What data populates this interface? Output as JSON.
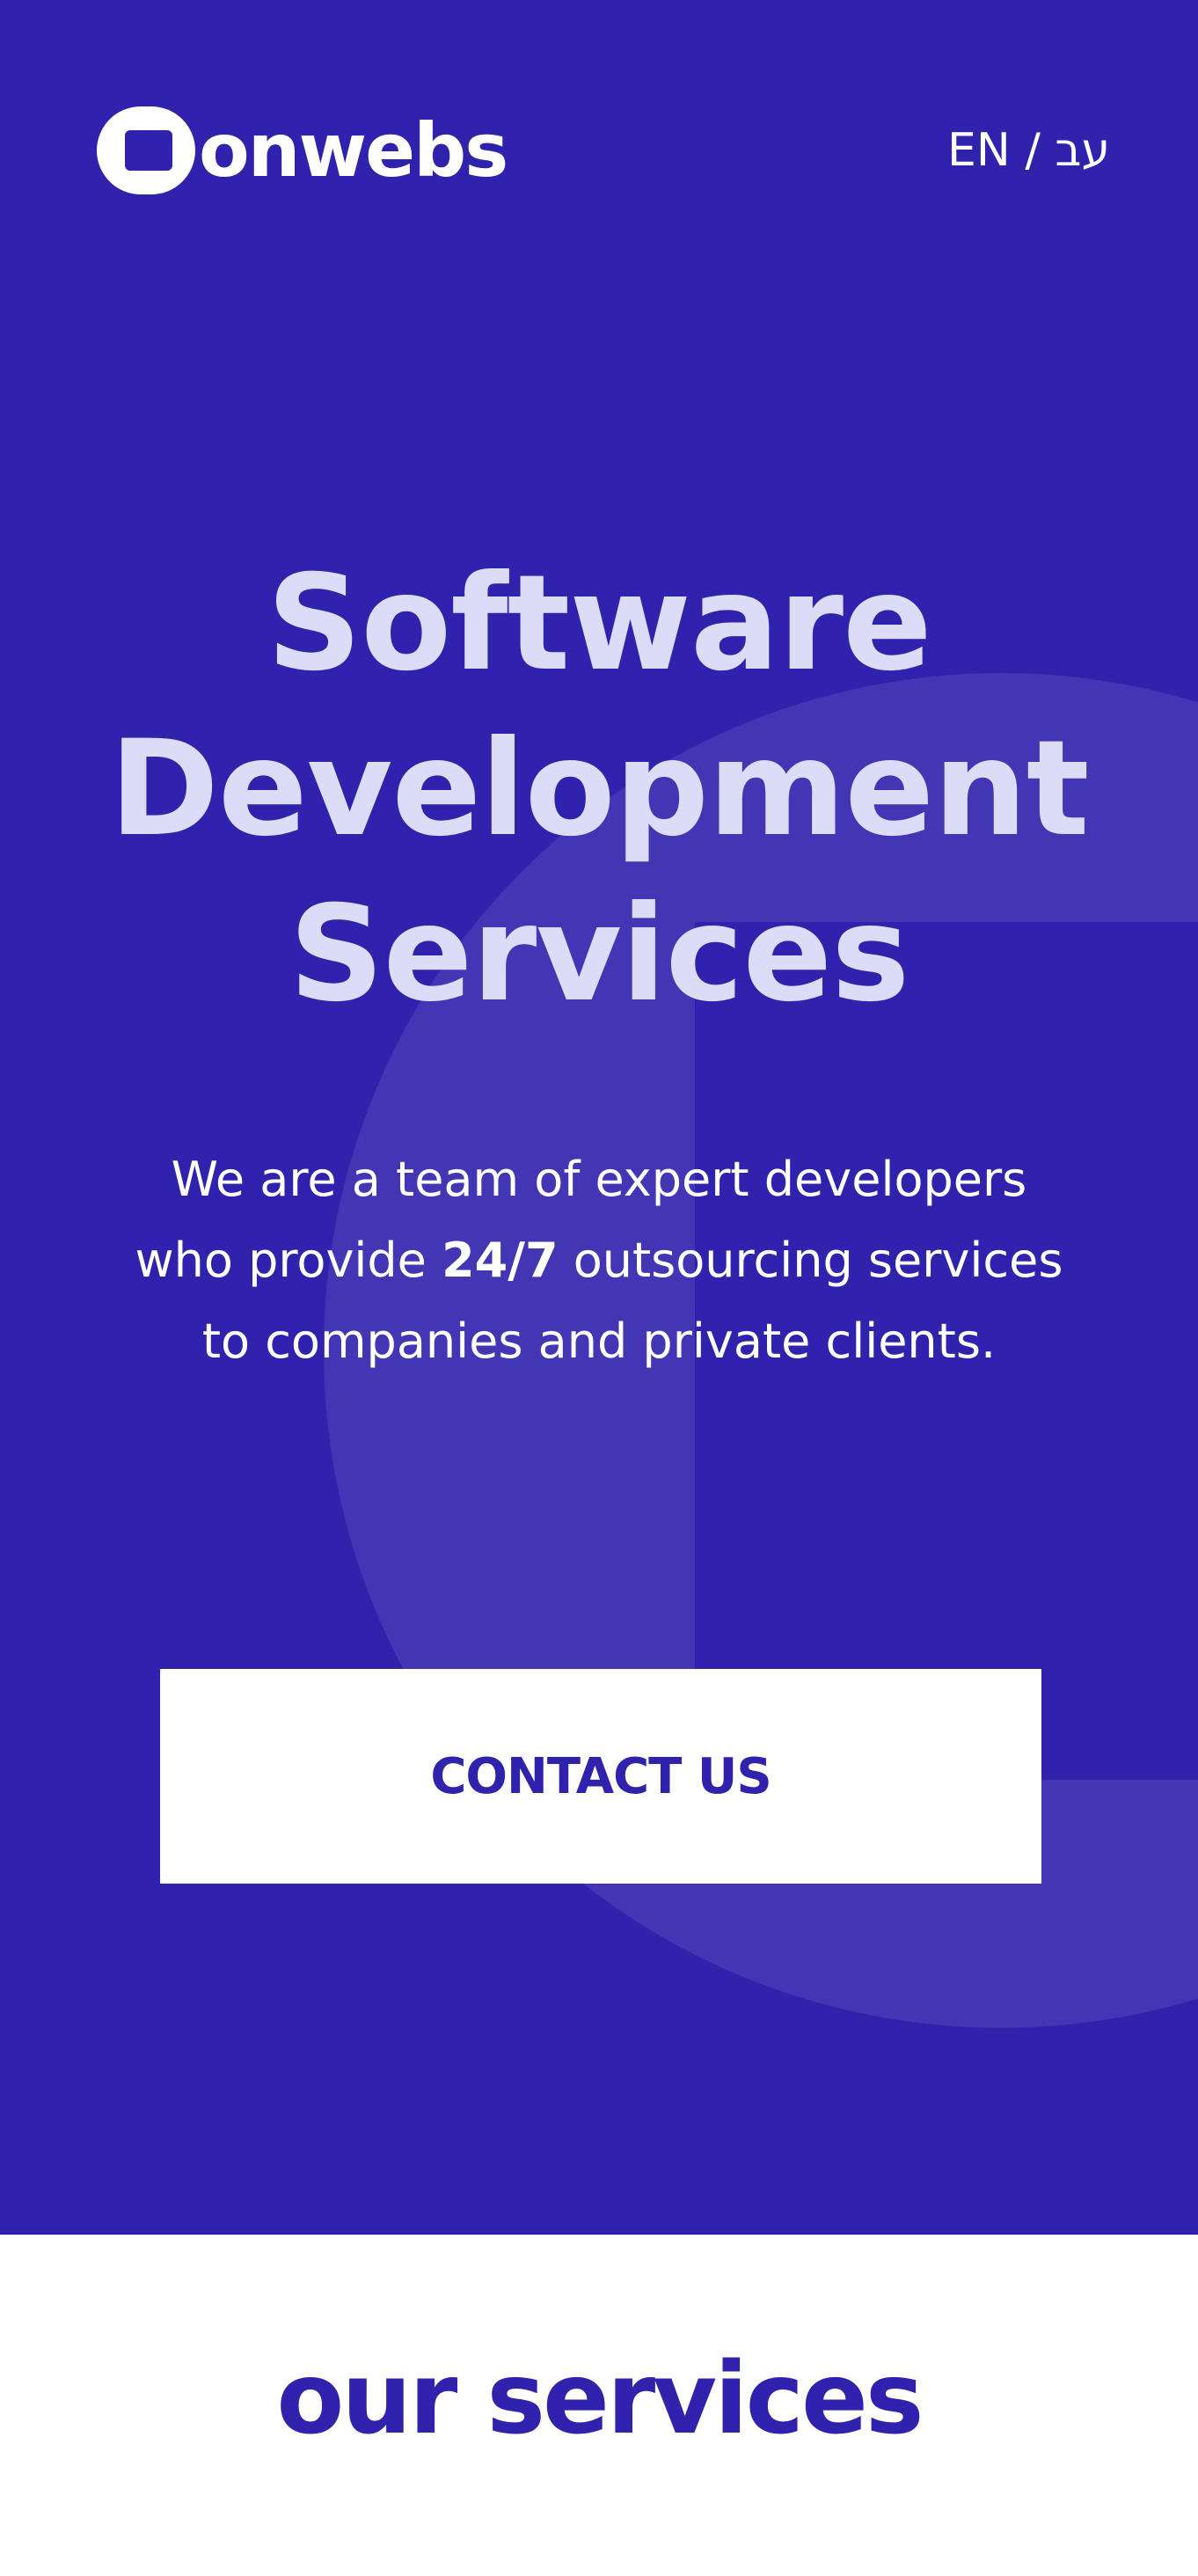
{
  "brand": {
    "name": "onwebs"
  },
  "header": {
    "lang_en": "EN",
    "lang_sep": "/",
    "lang_he": "עב"
  },
  "hero": {
    "title_line1": "Software",
    "title_line2": "Development",
    "title_line3": "Services",
    "desc_line1": "We are a team of expert developers",
    "desc_line2_pre": "who provide ",
    "desc_line2_bold": "24/7",
    "desc_line2_post": " outsourcing services",
    "desc_line3": "to companies and private clients.",
    "cta_label": "CONTACT US"
  },
  "services": {
    "title": "our services"
  },
  "colors": {
    "primary": "#2f22ad",
    "shape": "#4236b4",
    "title_text": "#dcdcf8",
    "white": "#ffffff"
  },
  "icons": {
    "logo": "rounded-square-logo-icon"
  }
}
